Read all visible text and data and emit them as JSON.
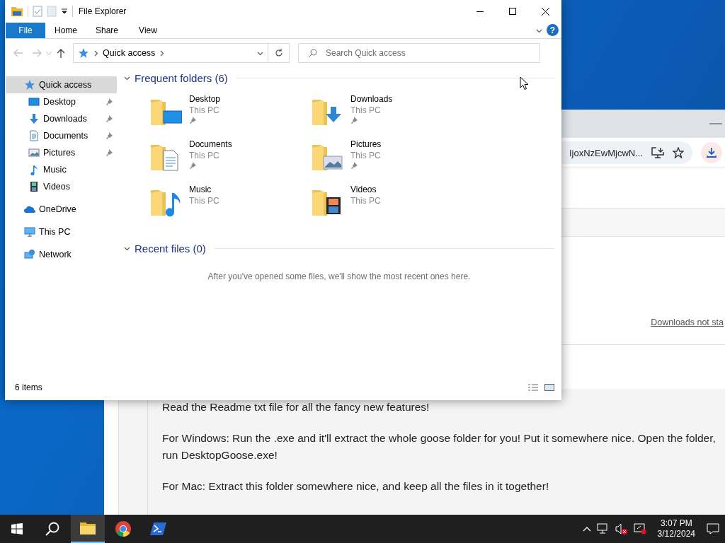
{
  "explorer": {
    "title": "File Explorer",
    "ribbon_tabs": [
      {
        "label": "File",
        "selected": true
      },
      {
        "label": "Home",
        "selected": false
      },
      {
        "label": "Share",
        "selected": false
      },
      {
        "label": "View",
        "selected": false
      }
    ],
    "help_button": "?",
    "address": {
      "crumbs": [
        "Quick access"
      ]
    },
    "search": {
      "placeholder": "Search Quick access"
    },
    "nav": [
      {
        "label": "Quick access",
        "kind": "star",
        "selected": true,
        "children": [
          {
            "label": "Desktop",
            "kind": "desktop",
            "pinned": true,
            "selected": false
          },
          {
            "label": "Downloads",
            "kind": "downloads",
            "pinned": true,
            "selected": false
          },
          {
            "label": "Documents",
            "kind": "documents",
            "pinned": true,
            "selected": false
          },
          {
            "label": "Pictures",
            "kind": "pictures",
            "pinned": true,
            "selected": false
          },
          {
            "label": "Music",
            "kind": "music",
            "pinned": false,
            "selected": false
          },
          {
            "label": "Videos",
            "kind": "videos",
            "pinned": false,
            "selected": false
          }
        ]
      },
      {
        "label": "OneDrive",
        "kind": "onedrive",
        "selected": false
      },
      {
        "label": "This PC",
        "kind": "thispc",
        "selected": false
      },
      {
        "label": "Network",
        "kind": "network",
        "selected": false
      }
    ],
    "sections": [
      {
        "title": "Frequent folders (6)",
        "expanded": true,
        "items": [
          {
            "name": "Desktop",
            "location": "This PC",
            "kind": "desktop",
            "pinned": true
          },
          {
            "name": "Downloads",
            "location": "This PC",
            "kind": "downloads",
            "pinned": true
          },
          {
            "name": "Documents",
            "location": "This PC",
            "kind": "documents",
            "pinned": true
          },
          {
            "name": "Pictures",
            "location": "This PC",
            "kind": "pictures",
            "pinned": true
          },
          {
            "name": "Music",
            "location": "This PC",
            "kind": "music",
            "pinned": false
          },
          {
            "name": "Videos",
            "location": "This PC",
            "kind": "videos",
            "pinned": false
          }
        ]
      },
      {
        "title": "Recent files (0)",
        "expanded": true,
        "empty_message": "After you've opened some files, we'll show the most recent ones here."
      }
    ],
    "status": "6 items"
  },
  "browser": {
    "url_tail": "IjoxNzEwMjcwN...",
    "link": "Downloads not sta",
    "paragraphs": [
      "Read the Readme txt file for all the fancy new features!",
      "For Windows: Run the .exe and it'll extract the whole goose folder for you! Put it somewhere nice. Open the folder, run DesktopGoose.exe!",
      "For Mac: Extract this folder somewhere nice, and keep all the files in it together!"
    ]
  },
  "taskbar": {
    "apps": [
      {
        "kind": "explorer",
        "active": true
      },
      {
        "kind": "chrome",
        "active": false
      },
      {
        "kind": "powershell",
        "active": false
      }
    ],
    "time": "3:07 PM",
    "date": "3/12/2024"
  }
}
